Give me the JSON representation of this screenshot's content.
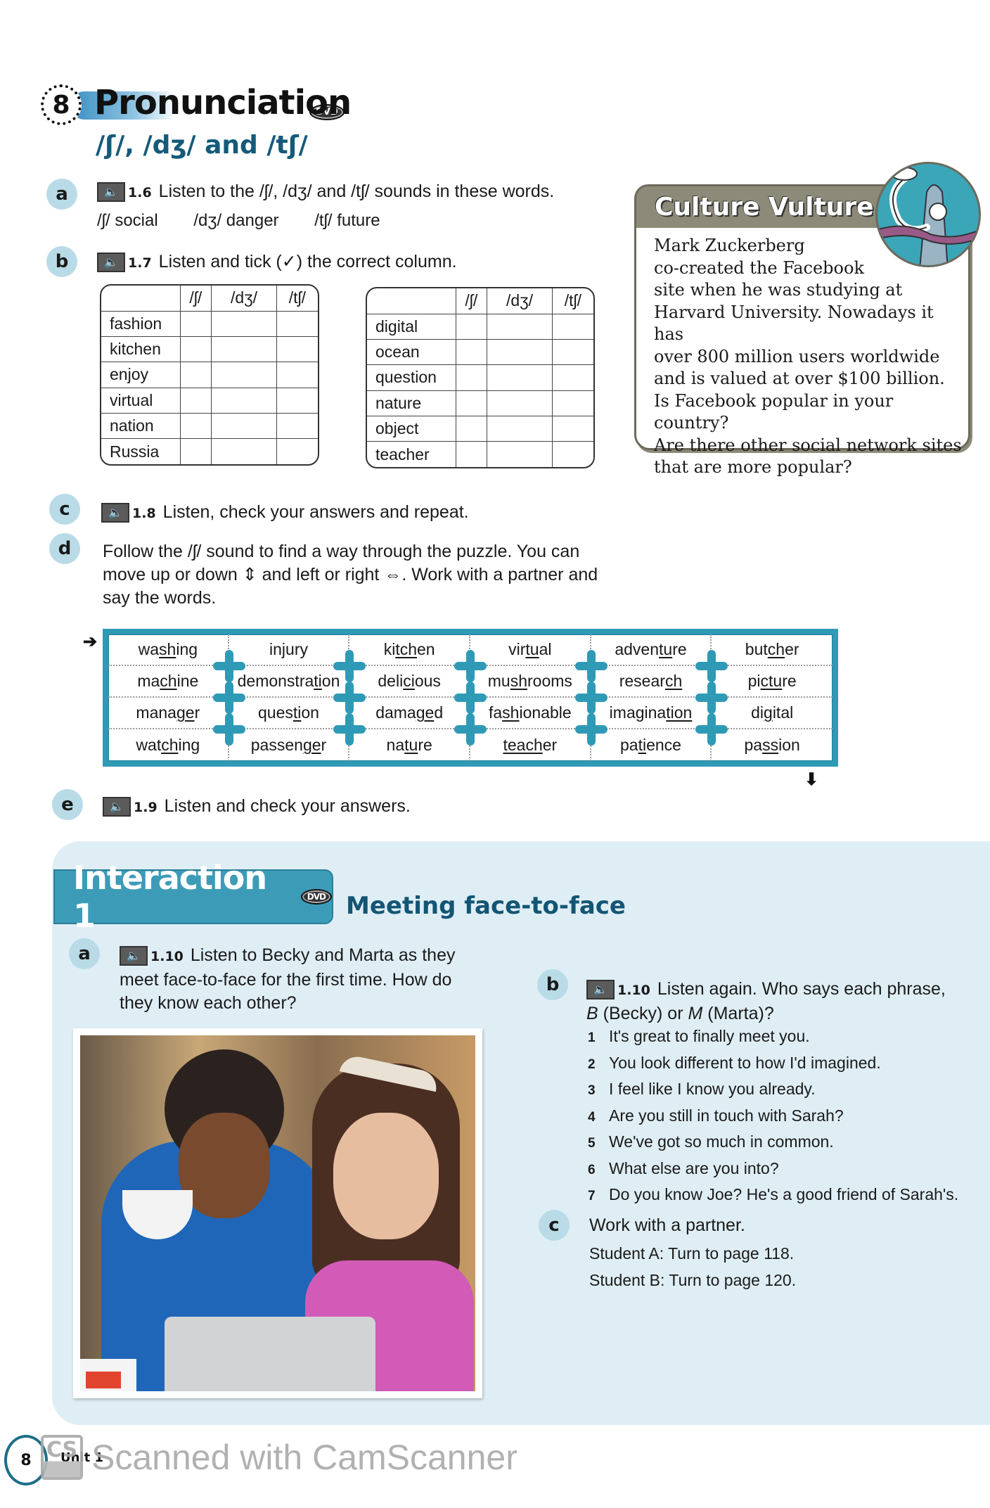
{
  "pronunciation": {
    "section_number": "8",
    "title": "Pronunciation",
    "dvd_label": "DVD",
    "subtitle": "/ʃ/, /dʒ/ and /tʃ/",
    "exercise_a": {
      "letter": "a",
      "track": "1.6",
      "instruction": "Listen to the /ʃ/, /dʒ/ and /tʃ/ sounds in these words.",
      "examples": [
        "/ʃ/  social",
        "/dʒ/  danger",
        "/tʃ/  future"
      ]
    },
    "exercise_b": {
      "letter": "b",
      "track": "1.7",
      "instruction": "Listen and tick (✓) the correct column.",
      "columns": [
        "/ʃ/",
        "/dʒ/",
        "/tʃ/"
      ],
      "table_left": [
        "fashion",
        "kitchen",
        "enjoy",
        "virtual",
        "nation",
        "Russia"
      ],
      "table_right": [
        "digital",
        "ocean",
        "question",
        "nature",
        "object",
        "teacher"
      ]
    },
    "exercise_c": {
      "letter": "c",
      "track": "1.8",
      "instruction": "Listen, check your answers and repeat."
    },
    "exercise_d": {
      "letter": "d",
      "instruction_lines": [
        "Follow the /ʃ/ sound to find a way through the puzzle. You can",
        "move up or down ⇕ and left or right ⇔. Work with a partner and",
        "say the words."
      ],
      "start_arrow": "➔",
      "end_arrow": "⬇",
      "puzzle_rows": [
        [
          {
            "pre": "wa",
            "u": "sh",
            "post": "ing"
          },
          {
            "pre": "in",
            "u": "j",
            "post": "ury"
          },
          {
            "pre": "ki",
            "u": "tch",
            "post": "en"
          },
          {
            "pre": "vir",
            "u": "tu",
            "post": "al"
          },
          {
            "pre": "adven",
            "u": "tu",
            "post": "re"
          },
          {
            "pre": "but",
            "u": "ch",
            "post": "er"
          }
        ],
        [
          {
            "pre": "ma",
            "u": "ch",
            "post": "ine"
          },
          {
            "pre": "demonstra",
            "u": "ti",
            "post": "on"
          },
          {
            "pre": "deli",
            "u": "ci",
            "post": "ous"
          },
          {
            "pre": "mu",
            "u": "sh",
            "post": "rooms"
          },
          {
            "pre": "resear",
            "u": "ch",
            "post": ""
          },
          {
            "pre": "pi",
            "u": "ctu",
            "post": "re"
          }
        ],
        [
          {
            "pre": "mana",
            "u": "ge",
            "post": "r"
          },
          {
            "pre": "ques",
            "u": "ti",
            "post": "on"
          },
          {
            "pre": "dama",
            "u": "ge",
            "post": "d"
          },
          {
            "pre": "fa",
            "u": "sh",
            "post": "ionable"
          },
          {
            "pre": "imagina",
            "u": "tion",
            "post": ""
          },
          {
            "pre": "di",
            "u": "g",
            "post": "ital"
          }
        ],
        [
          {
            "pre": "wat",
            "u": "ch",
            "post": "ing"
          },
          {
            "pre": "passen",
            "u": "ge",
            "post": "r"
          },
          {
            "pre": "na",
            "u": "tu",
            "post": "re"
          },
          {
            "pre": "",
            "u": "teach",
            "post": "er"
          },
          {
            "pre": "pa",
            "u": "ti",
            "post": "ence"
          },
          {
            "pre": "pa",
            "u": "ss",
            "post": "ion"
          }
        ]
      ]
    },
    "exercise_e": {
      "letter": "e",
      "track": "1.9",
      "instruction": "Listen and check your answers."
    }
  },
  "culture_vulture": {
    "title": "Culture Vulture",
    "text_lines": [
      "Mark Zuckerberg",
      "co-created the Facebook",
      "site when he was studying at",
      "Harvard University. Nowadays it has",
      "over 800 million users worldwide",
      "and is valued at over $100 billion.",
      "Is Facebook popular in your country?",
      "Are there other social network sites",
      "that are more popular?"
    ]
  },
  "interaction": {
    "title": "Interaction 1",
    "dvd_label": "DVD",
    "subtitle": "Meeting face-to-face",
    "exercise_a": {
      "letter": "a",
      "track": "1.10",
      "instruction_lines": [
        "Listen to Becky and Marta as they",
        "meet face-to-face for the first time. How do",
        "they know each other?"
      ]
    },
    "exercise_b": {
      "letter": "b",
      "track": "1.10",
      "instruction_line1": "Listen again. Who says each phrase,",
      "instruction_line2_parts": [
        "B",
        " (Becky) or ",
        "M",
        " (Marta)?"
      ],
      "phrases": [
        {
          "num": "1",
          "text": "It's great to finally meet you."
        },
        {
          "num": "2",
          "text": "You look different to how I'd imagined."
        },
        {
          "num": "3",
          "text": "I feel like I know you already."
        },
        {
          "num": "4",
          "text": "Are you still in touch with Sarah?"
        },
        {
          "num": "5",
          "text": "We've got so much in common."
        },
        {
          "num": "6",
          "text": "What else are you into?"
        },
        {
          "num": "7",
          "text": "Do you know Joe? He's a good friend of Sarah's."
        }
      ]
    },
    "exercise_c": {
      "letter": "c",
      "instruction": "Work with a partner.",
      "student_a": "Student A: Turn to page 118.",
      "student_b": "Student B: Turn to page 120."
    },
    "photo_alt": "Two young women looking at a laptop, one drinking from a cup"
  },
  "footer": {
    "page_number": "8",
    "unit_label": "Unit 1",
    "watermark_logo": "CS",
    "watermark_text": "Scanned with CamScanner"
  },
  "colors": {
    "accent_teal": "#2f9ab6",
    "heading_blue": "#145a7a",
    "letter_circle": "#b9dbe8",
    "culture_header": "#8c8a78",
    "interaction_bg": "#dfeef5"
  }
}
